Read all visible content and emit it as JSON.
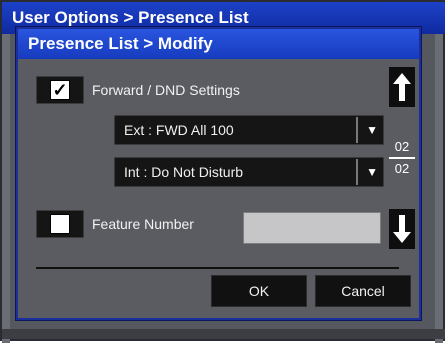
{
  "background_window": {
    "title": "User Options > Presence List"
  },
  "dialog": {
    "title": "Presence List > Modify",
    "forward_dnd": {
      "label": "Forward / DND Settings",
      "checked": true,
      "check_glyph": "✓"
    },
    "ext_dropdown": {
      "value": "Ext : FWD All 100",
      "arrow": "▼"
    },
    "int_dropdown": {
      "value": "Int : Do Not Disturb",
      "arrow": "▼"
    },
    "feature_number": {
      "label": "Feature Number",
      "checked": false,
      "value": ""
    },
    "pager": {
      "current": "02",
      "total": "02"
    },
    "buttons": {
      "ok": "OK",
      "cancel": "Cancel"
    },
    "icons": {
      "scroll_up": "up-arrow-icon",
      "scroll_down": "down-arrow-icon"
    }
  },
  "colors": {
    "title_bar": "#1d42c8",
    "panel": "#5a5c62",
    "button": "#111111"
  }
}
